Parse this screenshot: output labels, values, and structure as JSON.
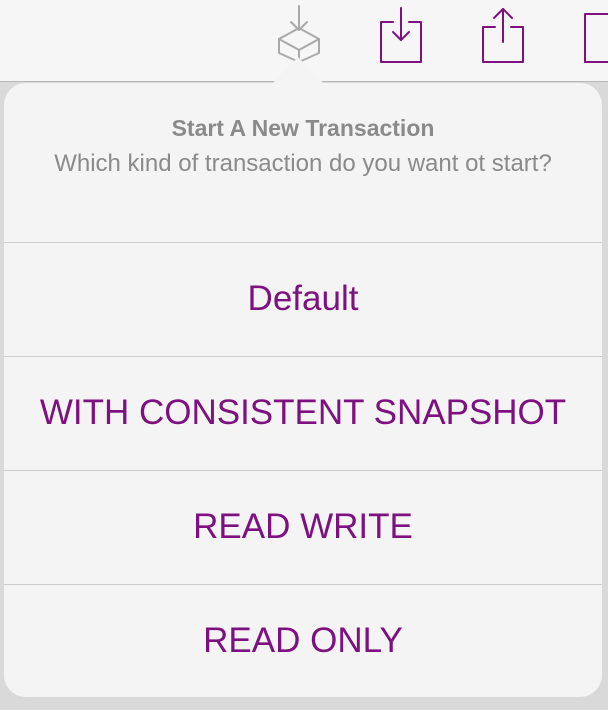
{
  "toolbar": {
    "buttons": [
      {
        "icon": "box-download-icon",
        "state": "disabled"
      },
      {
        "icon": "tray-download-icon",
        "state": "enabled"
      },
      {
        "icon": "share-icon",
        "state": "enabled"
      },
      {
        "icon": "document-icon",
        "state": "enabled"
      }
    ],
    "accent_color": "#7e1180",
    "disabled_color": "#a9a9a9"
  },
  "popover": {
    "title": "Start A New Transaction",
    "message": "Which kind of transaction do you want ot start?",
    "options": [
      {
        "label": "Default"
      },
      {
        "label": "WITH CONSISTENT SNAPSHOT"
      },
      {
        "label": "READ WRITE"
      },
      {
        "label": "READ ONLY"
      }
    ]
  }
}
